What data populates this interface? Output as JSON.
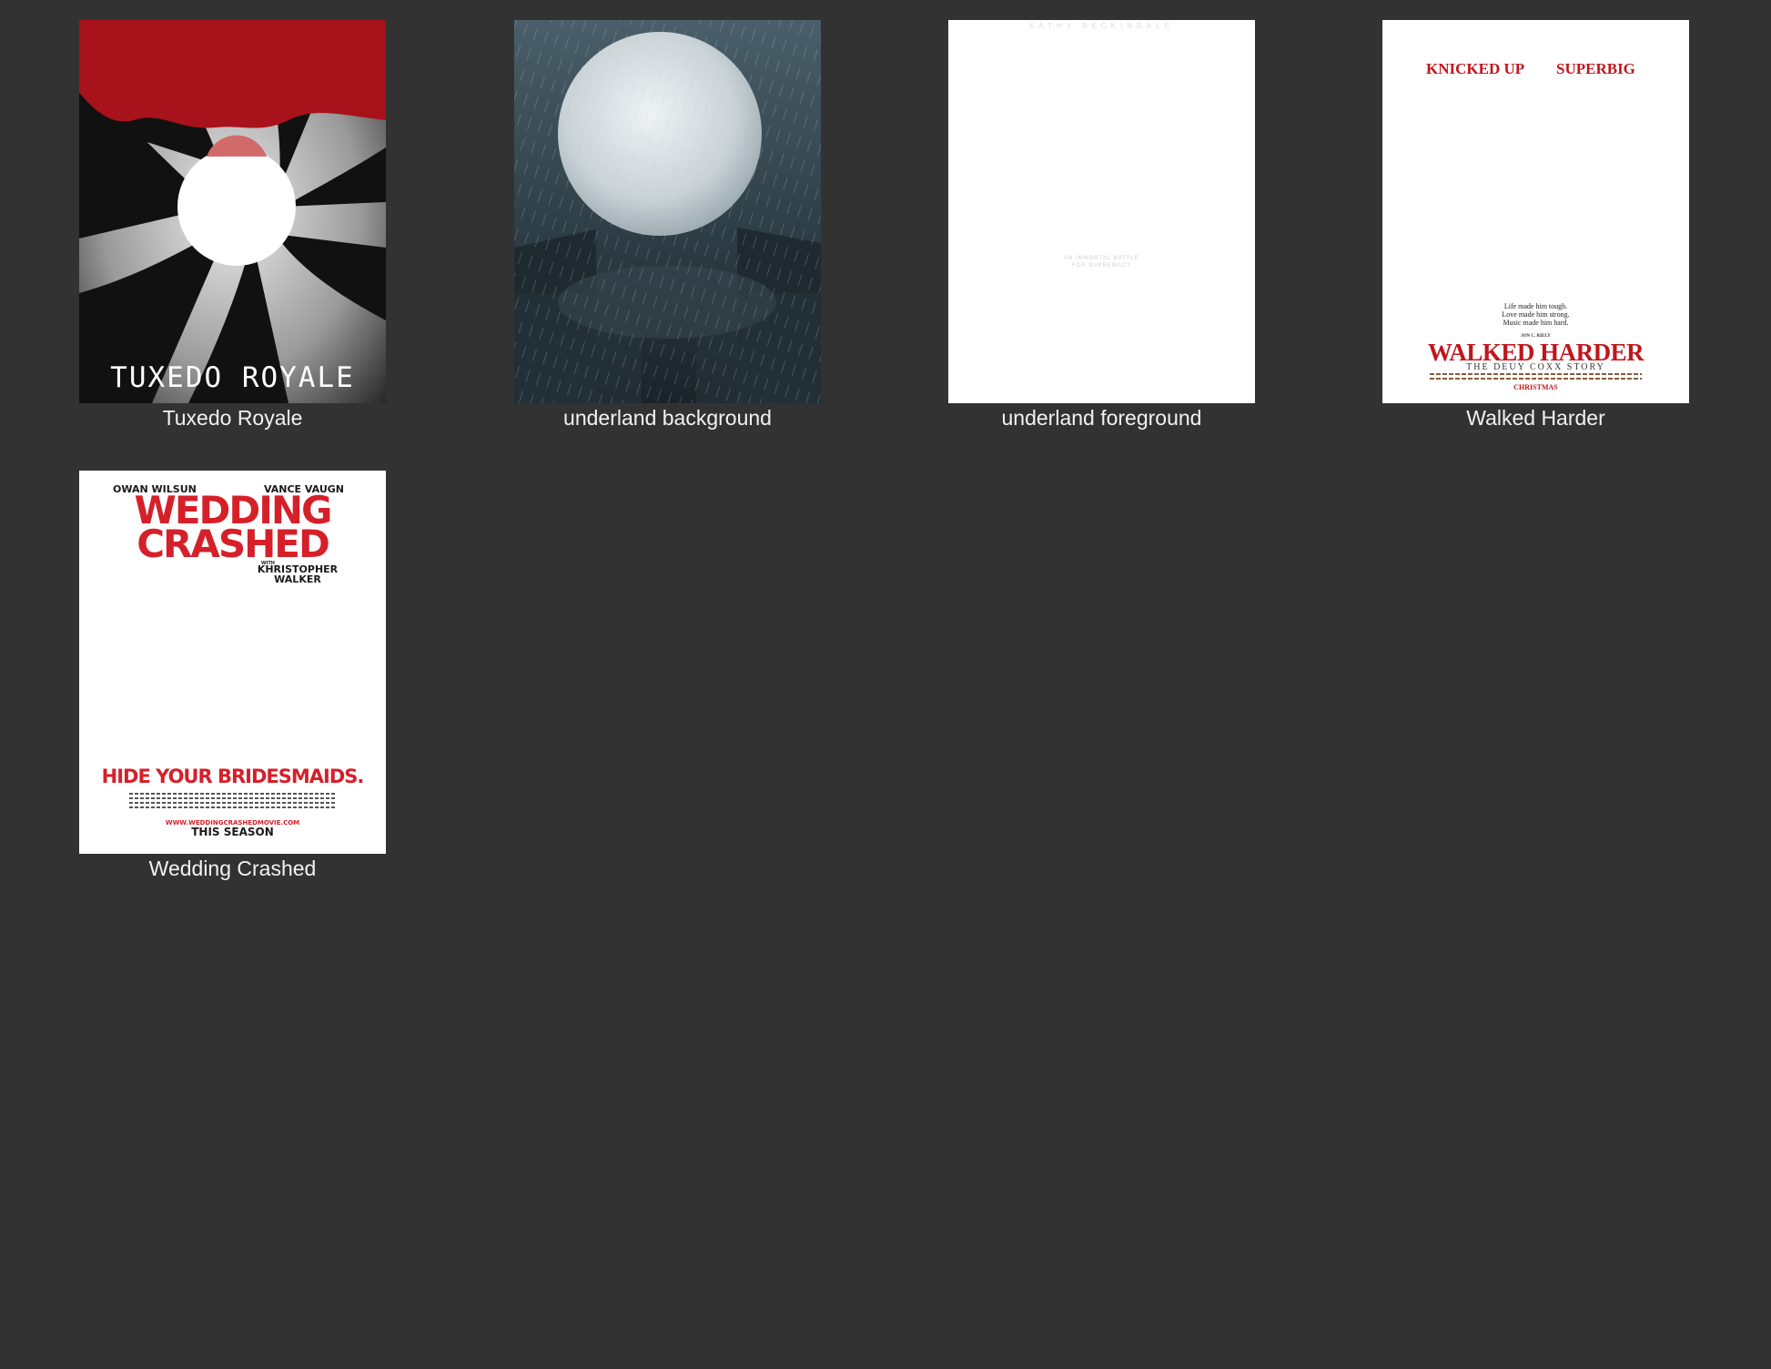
{
  "items": [
    {
      "caption": "Tuxedo Royale",
      "poster": {
        "title": "TUXEDO ROYALE"
      }
    },
    {
      "caption": "underland background"
    },
    {
      "caption": "underland foreground",
      "poster": {
        "name": "KATHY BECKINDALE",
        "tagline_1": "AN IMMORTAL BATTLE",
        "tagline_2": "FOR SUPREMACY"
      }
    },
    {
      "caption": "Walked Harder",
      "poster": {
        "top_left": "KNICKED UP",
        "top_right": "SUPERBIG",
        "tag_1": "Life made him tough.",
        "tag_2": "Love made him strong.",
        "tag_3": "Music made him hard.",
        "actor": "JON C. RIELY",
        "title": "WALKED HARDER",
        "subtitle": "THE DEUY COXX STORY",
        "release": "CHRISTMAS"
      }
    },
    {
      "caption": "Wedding Crashed",
      "poster": {
        "actor_left": "OWAN WILSUN",
        "actor_right": "VANCE VAUGN",
        "title_1": "WEDDING",
        "title_2": "CRASHED",
        "with": "WITH",
        "actor_extra_1": "KHRISTOPHER",
        "actor_extra_2": "WALKER",
        "tagline": "HIDE YOUR BRIDESMAIDS.",
        "url": "WWW.WEDDINGCRASHEDMOVIE.COM",
        "release": "THIS SEASON"
      }
    }
  ],
  "colors": {
    "background": "#323232",
    "caption": "#f2f2f2",
    "poster_red": "#d5202a"
  }
}
